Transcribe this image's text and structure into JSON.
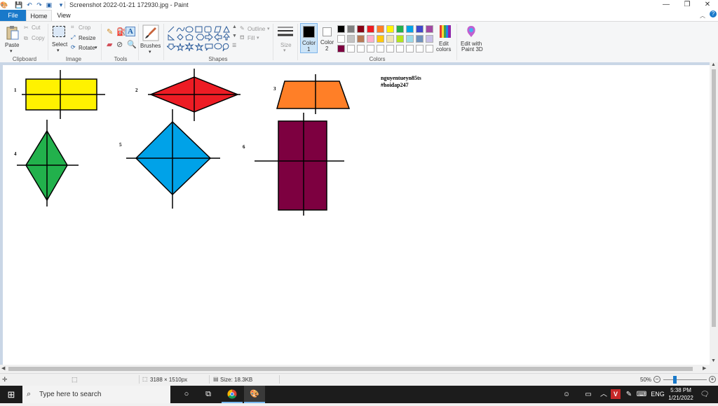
{
  "window": {
    "title": "Screenshot 2022-01-21 172930.jpg - Paint",
    "controls": [
      "—",
      "❐",
      "✕"
    ]
  },
  "tabs": {
    "file": "File",
    "home": "Home",
    "view": "View"
  },
  "ribbon": {
    "clipboard": {
      "group": "Clipboard",
      "paste": "Paste",
      "cut": "Cut",
      "copy": "Copy"
    },
    "image": {
      "group": "Image",
      "select": "Select",
      "crop": "Crop",
      "resize": "Resize",
      "rotate": "Rotate"
    },
    "tools": {
      "group": "Tools"
    },
    "brushes": {
      "label": "Brushes"
    },
    "shapes": {
      "group": "Shapes",
      "outline": "Outline",
      "fill": "Fill"
    },
    "size": {
      "label": "Size"
    },
    "colors": {
      "group": "Colors",
      "color1_label": "Color\n1",
      "color1_line1": "Color",
      "color1_line2": "1",
      "color2_line1": "Color",
      "color2_line2": "2",
      "color1_value": "#000000",
      "color2_value": "#ffffff",
      "edit_colors_line1": "Edit",
      "edit_colors_line2": "colors",
      "edit_paint3d_line1": "Edit with",
      "edit_paint3d_line2": "Paint 3D",
      "palette": [
        [
          "#000000",
          "#7f7f7f",
          "#880015",
          "#ed1c24",
          "#ff7f27",
          "#fff200",
          "#22b14c",
          "#00a2e8",
          "#3f48cc",
          "#a349a4"
        ],
        [
          "#ffffff",
          "#c3c3c3",
          "#b97a57",
          "#ffaec9",
          "#ffc90e",
          "#efe4b0",
          "#b5e61d",
          "#99d9ea",
          "#7092be",
          "#c8bfe7"
        ],
        [
          "#7d0040",
          "#ffffff",
          "#ffffff",
          "#ffffff",
          "#ffffff",
          "#ffffff",
          "#ffffff",
          "#ffffff",
          "#ffffff",
          "#ffffff"
        ]
      ]
    }
  },
  "drawing": {
    "labels": {
      "n1": "1",
      "n2": "2",
      "n3": "3",
      "n4": "4",
      "n5": "5",
      "n6": "6"
    },
    "credit_line1": "nguyentueyn85ts",
    "credit_line2": "#hoidap247",
    "fill_colors": {
      "rectangle": "#fff200",
      "rhombus_red": "#ed1c24",
      "trapezoid": "#ff7f27",
      "kite_green": "#22b14c",
      "square_blue": "#00a2e8",
      "rectangle_maroon": "#7d0040"
    }
  },
  "status": {
    "dimensions": "3188 × 1510px",
    "size": "Size: 18.3KB",
    "zoom": "50%"
  },
  "taskbar": {
    "search_placeholder": "Type here to search",
    "language": "ENG",
    "time": "5:38 PM",
    "date": "1/21/2022"
  }
}
